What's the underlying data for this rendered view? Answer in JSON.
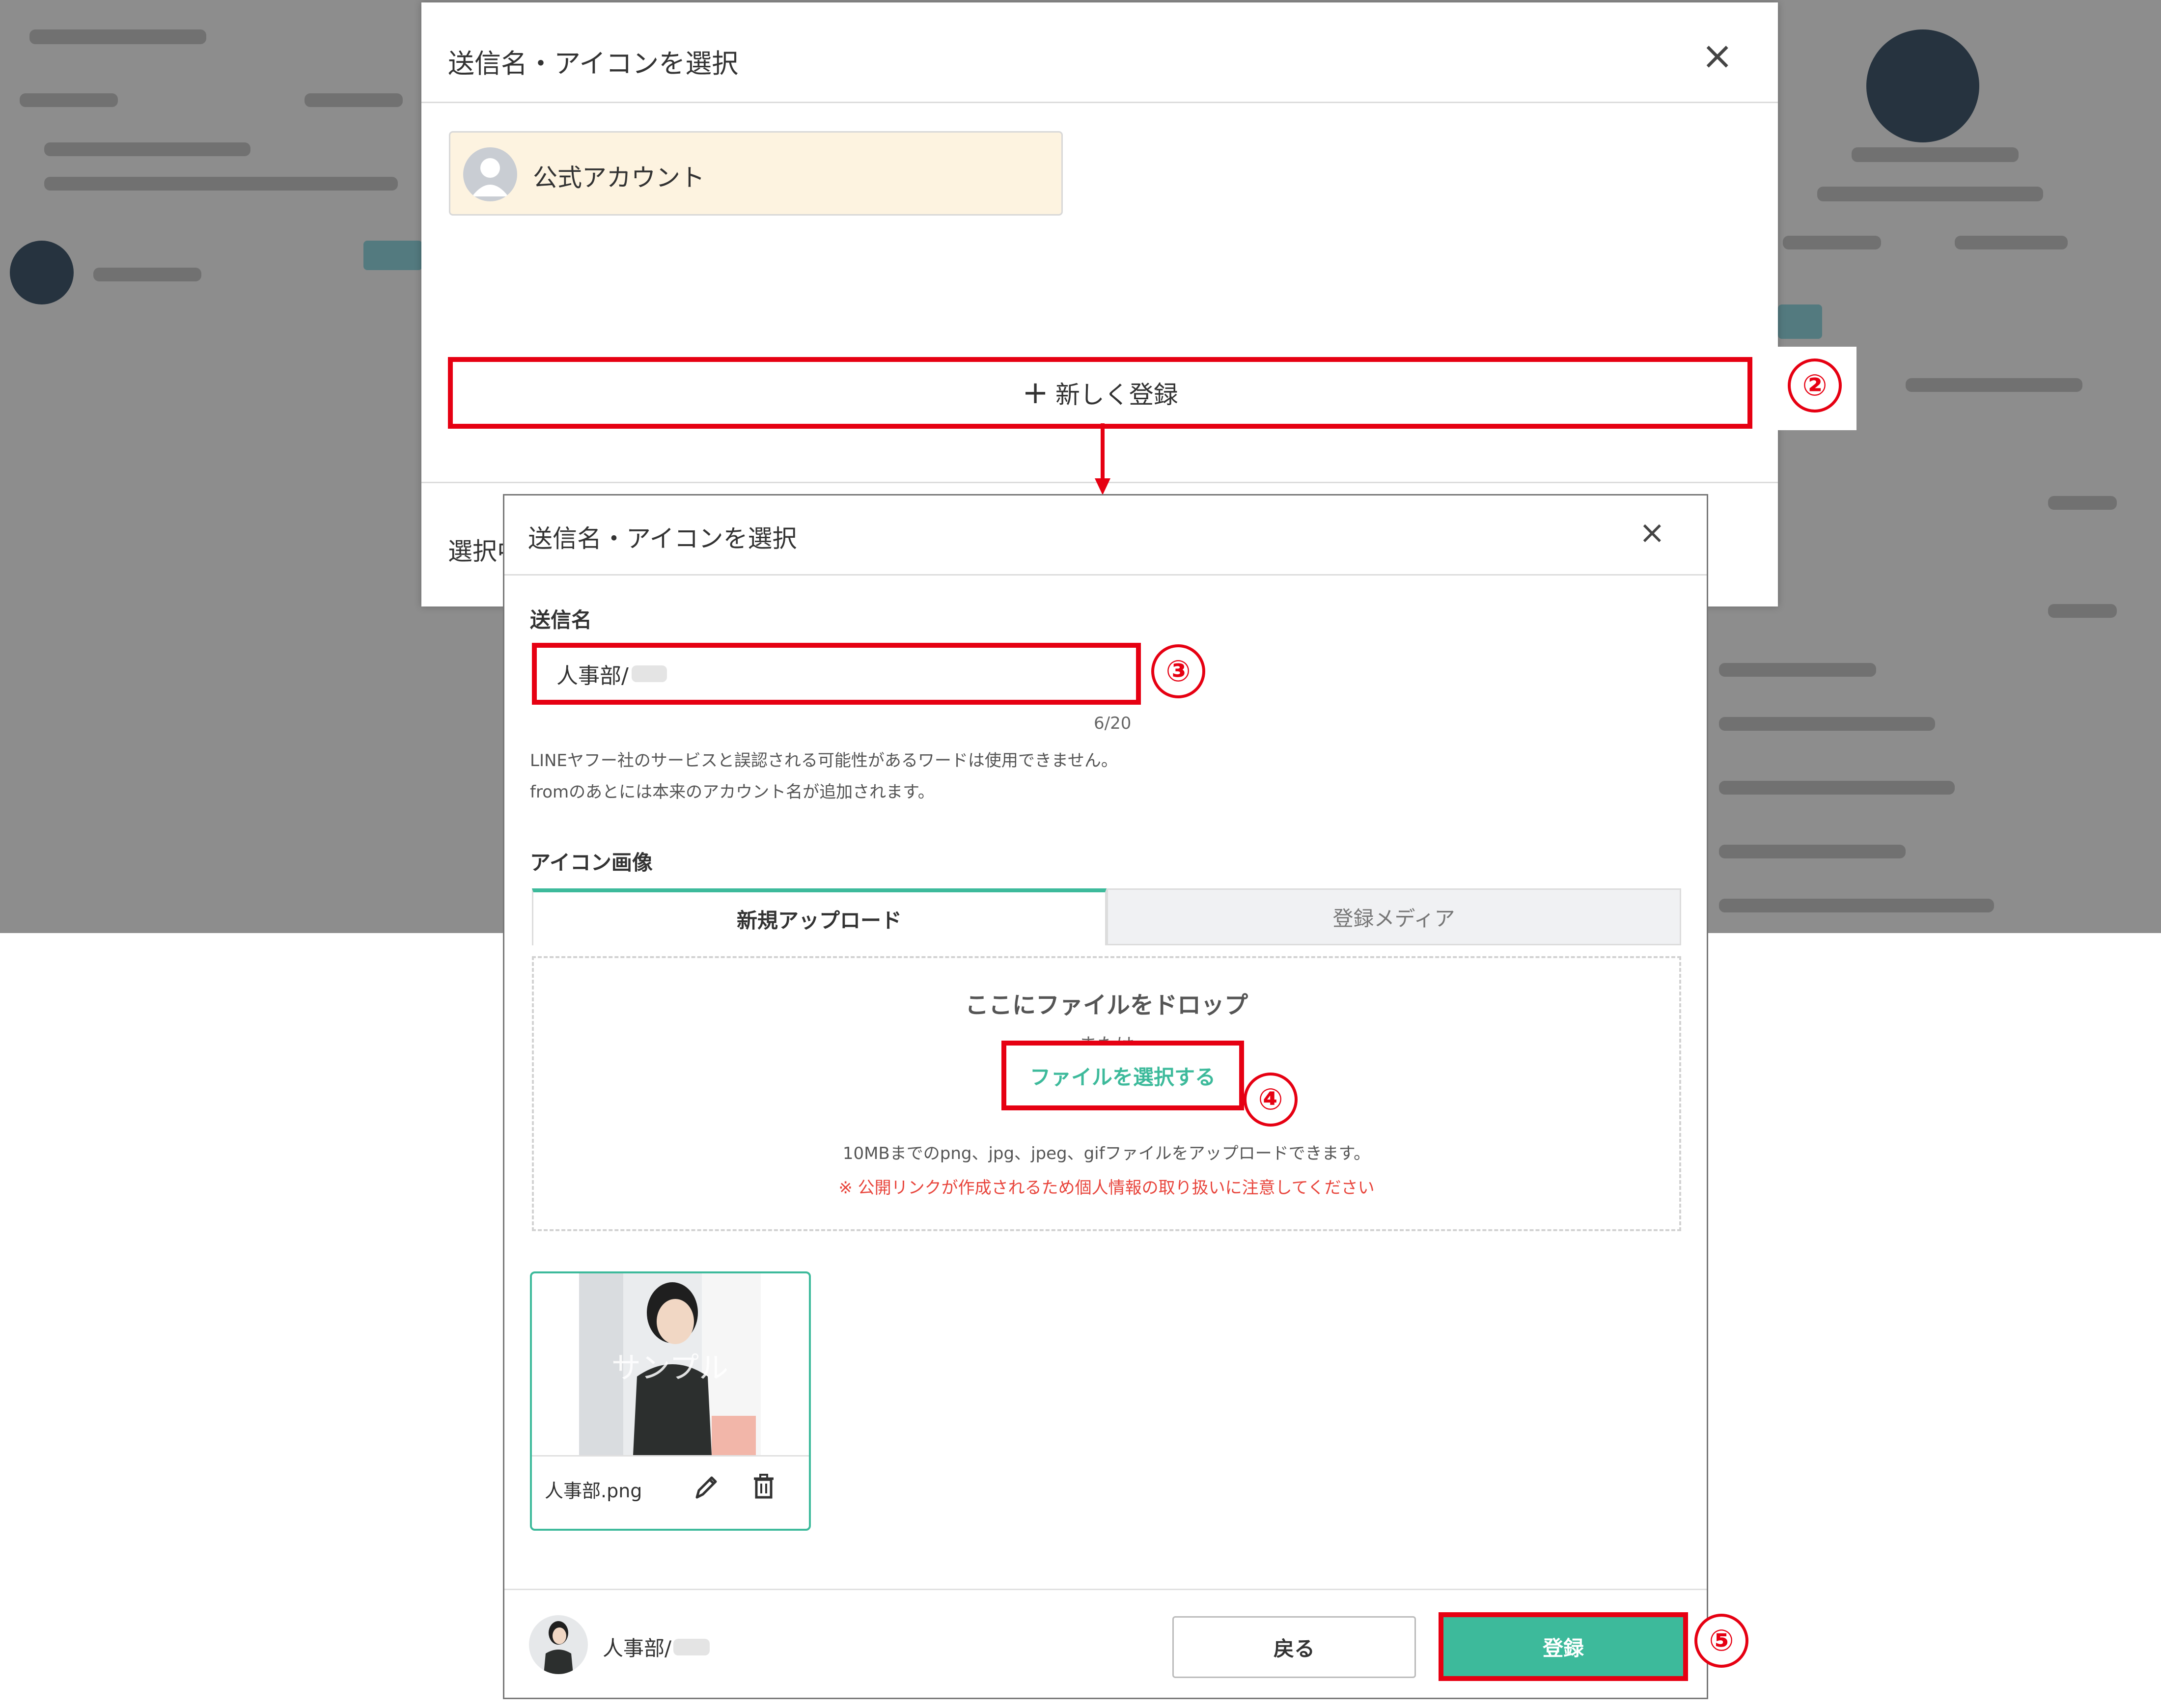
{
  "colors": {
    "accent": "#3dba9b",
    "highlight_red": "#e60012",
    "warning_text": "#e8453c",
    "account_card_bg": "#fdf3e0"
  },
  "dialog1": {
    "title": "送信名・アイコンを選択",
    "account_name": "公式アカウント",
    "new_register_label": "新しく登録",
    "new_register_icon": "plus-icon",
    "selected_prefix": "選択中",
    "close_icon": "close-icon"
  },
  "dialog2": {
    "title": "送信名・アイコンを選択",
    "close_icon": "close-icon",
    "sender_name_label": "送信名",
    "sender_name_value": "人事部/",
    "char_count": "6/20",
    "note1": "LINEヤフー社のサービスと誤認される可能性があるワードは使用できません。",
    "note2": "fromのあとには本来のアカウント名が追加されます。",
    "icon_image_label": "アイコン画像",
    "tabs": [
      {
        "label": "新規アップロード",
        "active": true
      },
      {
        "label": "登録メディア",
        "active": false
      }
    ],
    "dropzone": {
      "title": "ここにファイルをドロップ",
      "or": "または",
      "select_button": "ファイルを選択する",
      "limits": "10MBまでのpng、jpg、jpeg、gifファイルをアップロードできます。",
      "warning": "※ 公開リンクが作成されるため個人情報の取り扱いに注意してください"
    },
    "uploaded_image": {
      "watermark": "サンプル",
      "filename": "人事部.png",
      "edit_icon": "pencil-icon",
      "delete_icon": "trash-icon"
    },
    "footer": {
      "preview_name": "人事部/",
      "back_button": "戻る",
      "register_button": "登録"
    }
  },
  "steps": [
    "②",
    "③",
    "④",
    "⑤"
  ]
}
